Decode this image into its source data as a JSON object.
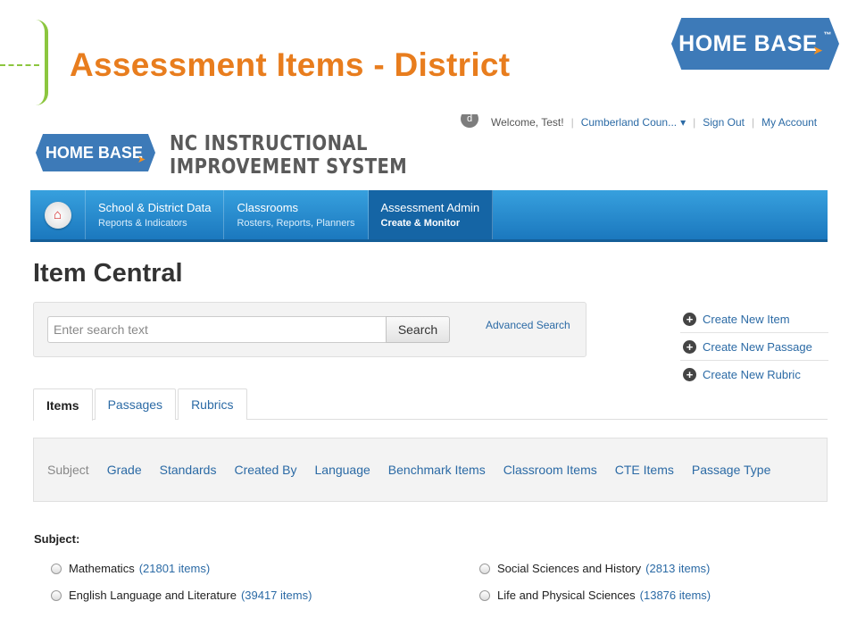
{
  "slide": {
    "title": "Assessment Items - District",
    "logo_text": "HOME BASE",
    "logo_mark": "™",
    "colors": {
      "title": "#e87d1e",
      "accent_green": "#8cc63f",
      "logo_blue": "#3d7ab8",
      "link_blue": "#2b6aa5",
      "nav_blue": "#1b78be"
    }
  },
  "header": {
    "logo_text": "HOME BASE",
    "system_name_line1": "NC INSTRUCTIONAL",
    "system_name_line2": "IMPROVEMENT SYSTEM",
    "user_bar": {
      "avatar": "d",
      "welcome": "Welcome, Test!",
      "org": "Cumberland Coun...",
      "org_caret": "▾",
      "sign_out": "Sign Out",
      "account": "My Account"
    }
  },
  "nav": {
    "home_icon": "home-icon",
    "items": [
      {
        "title": "School & District Data",
        "subtitle": "Reports & Indicators"
      },
      {
        "title": "Classrooms",
        "subtitle": "Rosters, Reports, Planners"
      },
      {
        "title": "Assessment Admin",
        "subtitle": "Create & Monitor"
      }
    ],
    "active_index": 2
  },
  "page": {
    "title": "Item Central",
    "search": {
      "placeholder": "Enter search text",
      "value": "",
      "button": "Search",
      "advanced": "Advanced Search"
    },
    "actions": [
      {
        "label": "Create New Item"
      },
      {
        "label": "Create New Passage"
      },
      {
        "label": "Create New Rubric"
      }
    ],
    "tabs": [
      {
        "label": "Items"
      },
      {
        "label": "Passages"
      },
      {
        "label": "Rubrics"
      }
    ],
    "active_tab": 0,
    "filters": [
      "Subject",
      "Grade",
      "Standards",
      "Created By",
      "Language",
      "Benchmark Items",
      "Classroom Items",
      "CTE Items",
      "Passage Type"
    ],
    "subject_label": "Subject:",
    "subjects": [
      {
        "name": "Mathematics",
        "count": "(21801 items)"
      },
      {
        "name": "English Language and Literature",
        "count": "(39417 items)"
      },
      {
        "name": "Social Sciences and History",
        "count": "(2813 items)"
      },
      {
        "name": "Life and Physical Sciences",
        "count": "(13876 items)"
      }
    ]
  }
}
